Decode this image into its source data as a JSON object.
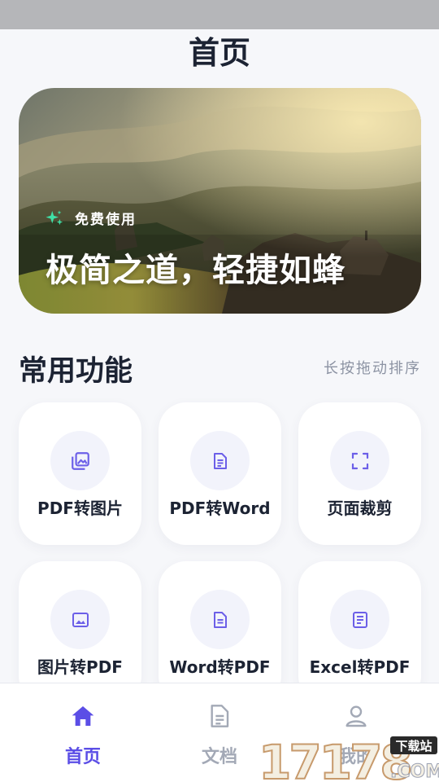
{
  "header": {
    "title": "首页"
  },
  "banner": {
    "tag_icon": "sparkle-icon",
    "tag": "免费使用",
    "slogan": "极简之道，轻捷如蜂"
  },
  "section": {
    "title": "常用功能",
    "hint": "长按拖动排序"
  },
  "features": [
    {
      "label": "PDF转图片",
      "icon": "images-icon"
    },
    {
      "label": "PDF转Word",
      "icon": "document-text-icon"
    },
    {
      "label": "页面裁剪",
      "icon": "crop-frame-icon"
    },
    {
      "label": "图片转PDF",
      "icon": "image-icon"
    },
    {
      "label": "Word转PDF",
      "icon": "word-doc-icon"
    },
    {
      "label": "Excel转PDF",
      "icon": "excel-doc-icon"
    }
  ],
  "tabbar": {
    "items": [
      {
        "label": "首页",
        "icon": "home-icon",
        "active": true
      },
      {
        "label": "文档",
        "icon": "document-icon",
        "active": false
      },
      {
        "label": "我的",
        "icon": "user-icon",
        "active": false
      }
    ]
  },
  "watermark": {
    "number": "17178",
    "badge": "下载站",
    "domain": ".COM"
  },
  "colors": {
    "accent": "#5b4ee6",
    "icon_tint": "#6c5fe8",
    "text_primary": "#1c2333",
    "text_muted": "#8c93a3",
    "tab_inactive": "#a3a9b6",
    "sparkle": "#3fe0a6"
  }
}
